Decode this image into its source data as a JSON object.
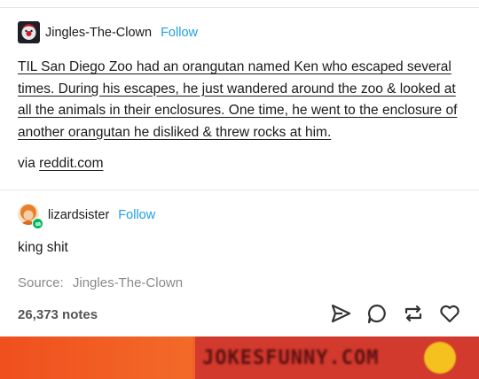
{
  "post": {
    "username": "Jingles-The-Clown",
    "follow_label": "Follow",
    "body_text": "TIL San Diego Zoo had an orangutan named Ken who escaped several times. During his escapes, he just wandered around the zoo & looked at all the animals in their enclosures. One time, he went to the enclosure of another orangutan he disliked & threw rocks at him.",
    "via_label": "via",
    "via_link": "reddit.com"
  },
  "reblog": {
    "username": "lizardsister",
    "follow_label": "Follow",
    "comment": "king shit",
    "source_label": "Source:",
    "source_name": "Jingles-The-Clown"
  },
  "footer": {
    "notes": "26,373 notes",
    "icons": [
      "share-icon",
      "reply-icon",
      "reblog-icon",
      "like-icon"
    ]
  },
  "banner": {
    "text": "JOKESFUNNY.COM"
  },
  "colors": {
    "follow": "#1ea0e6",
    "reblog_badge": "#00b85c",
    "banner": "#e8452a"
  }
}
